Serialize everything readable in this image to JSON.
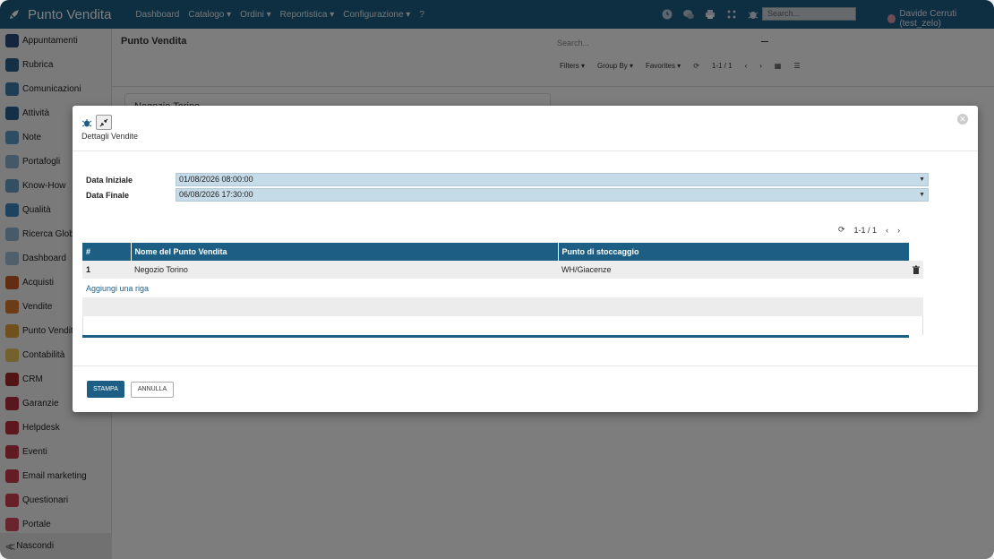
{
  "app": {
    "brand": "Punto Vendita",
    "menu": [
      "Dashboard",
      "Catalogo ▾",
      "Ordini ▾",
      "Reportistica ▾",
      "Configurazione ▾",
      "?"
    ],
    "search_placeholder": "Search...",
    "user": "Davide Cerruti (test_zelo)"
  },
  "sidebar": {
    "items": [
      {
        "label": "Appuntamenti",
        "color": "#2b4a7a"
      },
      {
        "label": "Rubrica",
        "color": "#2b5f8a"
      },
      {
        "label": "Comunicazioni",
        "color": "#3a7ca8"
      },
      {
        "label": "Attività",
        "color": "#2a5f8f"
      },
      {
        "label": "Note",
        "color": "#5c9bc6"
      },
      {
        "label": "Portafogli",
        "color": "#8ab0cf"
      },
      {
        "label": "Know-How",
        "color": "#6a9fc5"
      },
      {
        "label": "Qualità",
        "color": "#3f87bd"
      },
      {
        "label": "Ricerca Globale",
        "color": "#8fb5d4"
      },
      {
        "label": "Dashboard",
        "color": "#9fbfd8"
      },
      {
        "label": "Acquisti",
        "color": "#c65a2a"
      },
      {
        "label": "Vendite",
        "color": "#d9782f"
      },
      {
        "label": "Punto Vendita",
        "color": "#e0a33a"
      },
      {
        "label": "Contabilità",
        "color": "#e6c55a"
      },
      {
        "label": "CRM",
        "color": "#a32a2a"
      },
      {
        "label": "Garanzie",
        "color": "#b02c3e"
      },
      {
        "label": "Helpdesk",
        "color": "#b8303a"
      },
      {
        "label": "Eventi",
        "color": "#c03545"
      },
      {
        "label": "Email marketing",
        "color": "#c83a4a"
      },
      {
        "label": "Questionari",
        "color": "#d04050"
      },
      {
        "label": "Portale",
        "color": "#d04a5a"
      }
    ],
    "hide_label": "Nascondi"
  },
  "background": {
    "title": "Punto Vendita",
    "search_placeholder": "Search...",
    "filters": "Filters ▾",
    "group_by": "Group By ▾",
    "favorites": "Favorites ▾",
    "pager": "1-1 / 1",
    "card_title": "Negozio Torino"
  },
  "modal": {
    "title": "Dettagli Vendite",
    "data_iniziale_label": "Data Iniziale",
    "data_iniziale_value": "01/08/2026 08:00:00",
    "data_finale_label": "Data Finale",
    "data_finale_value": "06/08/2026 17:30:00",
    "pager": "1-1 / 1",
    "columns": [
      "#",
      "Nome del Punto Vendita",
      "Punto di stoccaggio"
    ],
    "rows": [
      {
        "num": "1",
        "nome": "Negozio Torino",
        "stoccaggio": "WH/Giacenze"
      }
    ],
    "add_row": "Aggiungi una riga",
    "stampa": "STAMPA",
    "annulla": "ANNULLA"
  }
}
